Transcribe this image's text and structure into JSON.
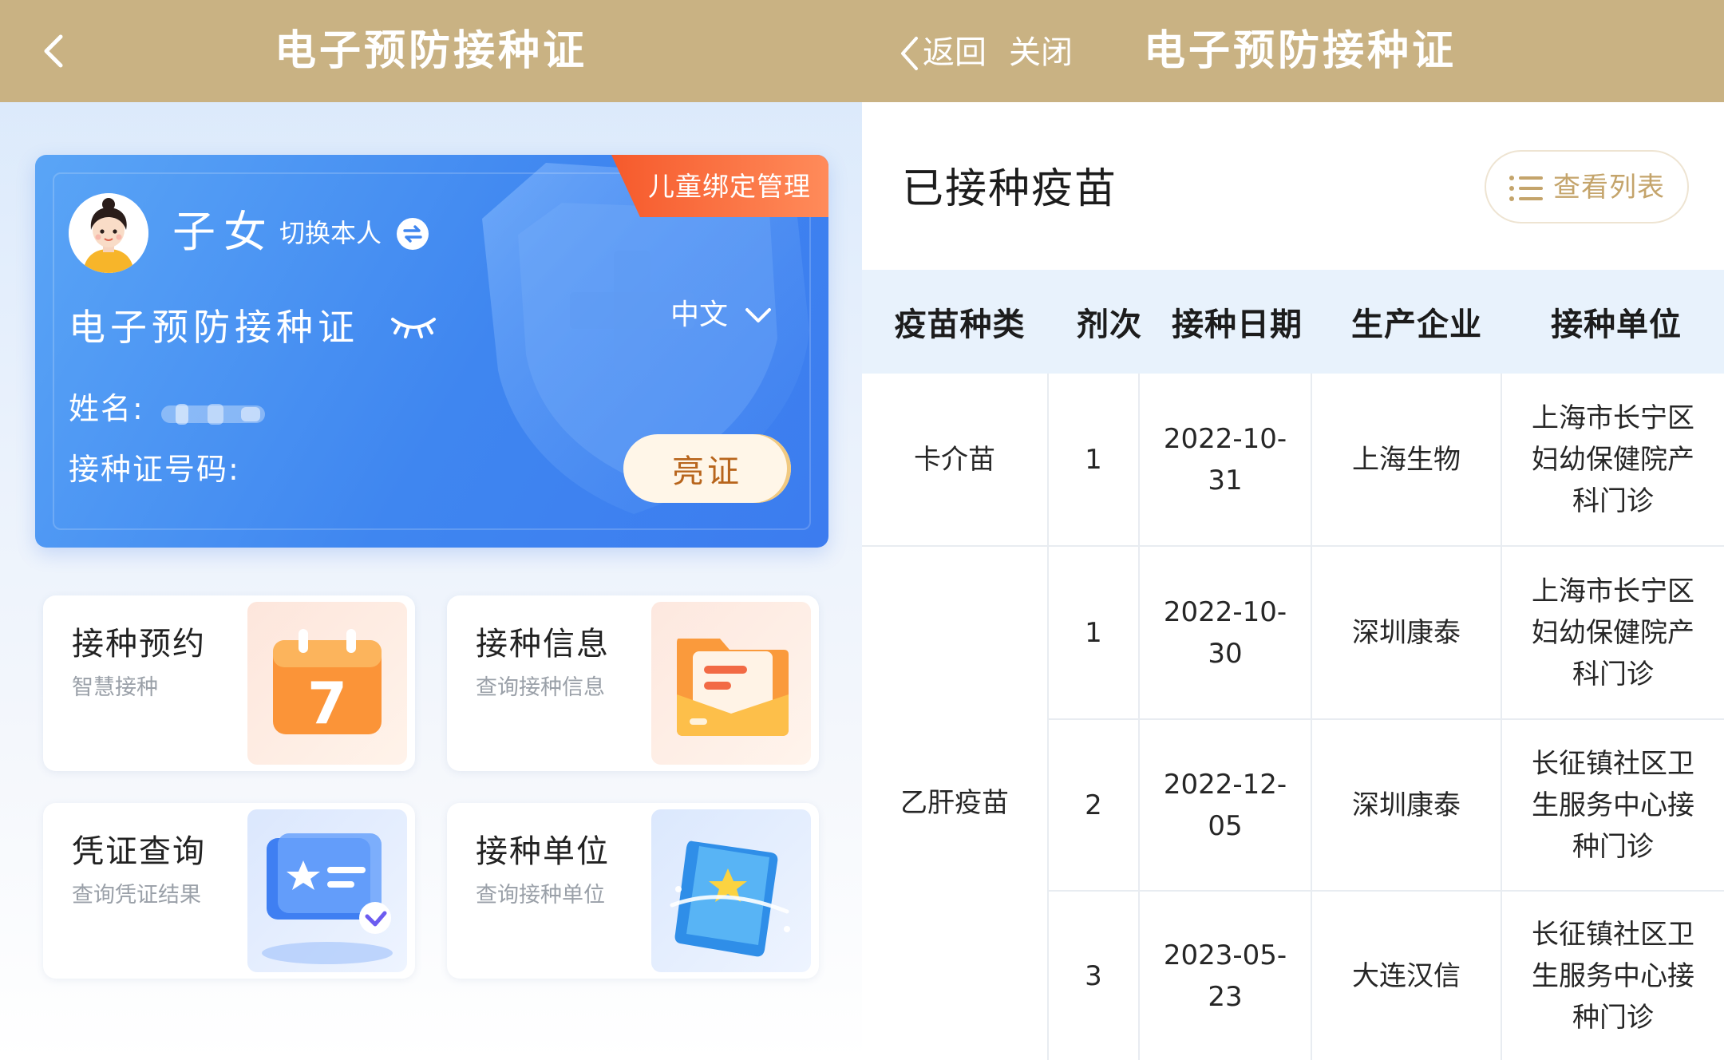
{
  "left": {
    "header": {
      "title": "电子预防接种证"
    },
    "card": {
      "badge": "儿童绑定管理",
      "relation": "子女",
      "switch_label": "切换本人",
      "title": "电子预防接种证",
      "language": "中文",
      "name_label": "姓名:",
      "id_label": "接种证号码:",
      "show_button": "亮证"
    },
    "tiles": [
      {
        "title": "接种预约",
        "subtitle": "智慧接种",
        "icon": "calendar-icon",
        "calendar_day": "7"
      },
      {
        "title": "接种信息",
        "subtitle": "查询接种信息",
        "icon": "folder-icon"
      },
      {
        "title": "凭证查询",
        "subtitle": "查询凭证结果",
        "icon": "certificate-icon"
      },
      {
        "title": "接种单位",
        "subtitle": "查询接种单位",
        "icon": "book-icon"
      }
    ]
  },
  "right": {
    "nav": {
      "back_label": "返回",
      "close_label": "关闭",
      "title": "电子预防接种证"
    },
    "section": {
      "title": "已接种疫苗",
      "list_button": "查看列表"
    },
    "table": {
      "headers": [
        "疫苗种类",
        "剂次",
        "接种日期",
        "生产企业",
        "接种单位"
      ],
      "groups": [
        {
          "vaccine": "卡介苗"
        },
        {
          "vaccine": "乙肝疫苗"
        }
      ],
      "rows": [
        {
          "dose": "1",
          "date": [
            "2022-10-",
            "31"
          ],
          "maker": "上海生物",
          "unit": [
            "上海市长宁区",
            "妇幼保健院产",
            "科门诊"
          ]
        },
        {
          "dose": "1",
          "date": [
            "2022-10-",
            "30"
          ],
          "maker": "深圳康泰",
          "unit": [
            "上海市长宁区",
            "妇幼保健院产",
            "科门诊"
          ]
        },
        {
          "dose": "2",
          "date": [
            "2022-12-",
            "05"
          ],
          "maker": "深圳康泰",
          "unit": [
            "长征镇社区卫",
            "生服务中心接",
            "种门诊"
          ]
        },
        {
          "dose": "3",
          "date": [
            "2023-05-",
            "23"
          ],
          "maker": "大连汉信",
          "unit": [
            "长征镇社区卫",
            "生服务中心接",
            "种门诊"
          ]
        }
      ]
    }
  },
  "colors": {
    "header_bg": "#c9b283",
    "card_blue": "#3f86f0",
    "badge_orange": "#f36a3a",
    "table_header_bg": "#e8f2fc",
    "list_button_text": "#c4a46b"
  }
}
